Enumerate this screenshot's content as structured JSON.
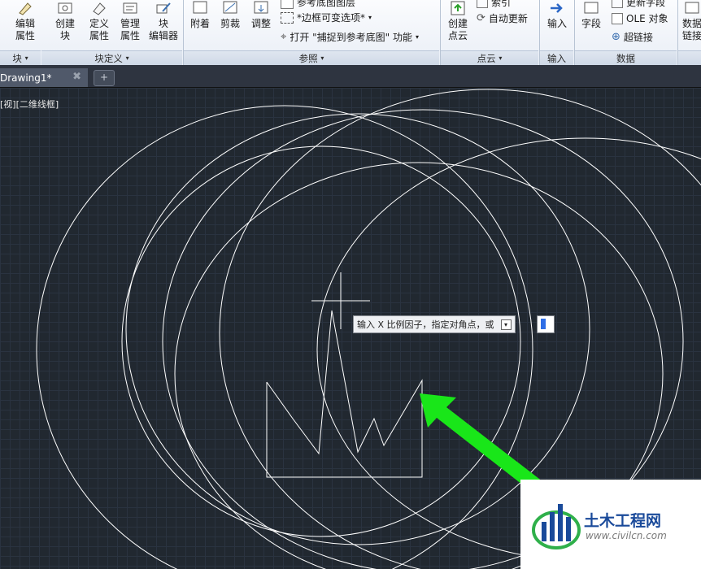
{
  "ribbon": {
    "tools": [
      {
        "id": "edit-attributes",
        "label_top": "编辑",
        "label_bottom": "属性"
      },
      {
        "id": "create-block",
        "label_top": "创建",
        "label_bottom": "块"
      },
      {
        "id": "define-attributes",
        "label_top": "定义",
        "label_bottom": "属性"
      },
      {
        "id": "manage-attributes",
        "label_top": "管理",
        "label_bottom": "属性"
      },
      {
        "id": "block-editor",
        "label_top": "块",
        "label_bottom": "编辑器"
      },
      {
        "id": "attach",
        "label_top": "附着"
      },
      {
        "id": "clip",
        "label_top": "剪裁"
      },
      {
        "id": "adjust",
        "label_top": "调整"
      },
      {
        "id": "create-point-cloud",
        "label_top": "创建",
        "label_bottom": "点云"
      },
      {
        "id": "input",
        "label_top": "输入"
      },
      {
        "id": "field",
        "label_top": "字段"
      },
      {
        "id": "data-link",
        "label_top": "数据",
        "label_bottom": "链接"
      }
    ],
    "small_items": {
      "underlay_layers": "参考底图图层",
      "frame_variable": "*边框可变选项*",
      "open_snap": "打开 \"捕捉到参考底图\" 功能",
      "index": "索引",
      "auto_update": "自动更新",
      "update_fields": "更新字段",
      "ole_object": "OLE 对象",
      "hyperlink": "超链接"
    },
    "panels": {
      "block": "块",
      "block_definition": "块定义",
      "reference": "参照",
      "point_cloud": "点云",
      "import": "输入",
      "data": "数据"
    }
  },
  "tabs": [
    {
      "title": "Drawing1*"
    }
  ],
  "viewport_label": "[视][二维线框]",
  "prompt": {
    "tooltip_text": "输入 X 比例因子，指定对角点，或",
    "input_value": ""
  },
  "watermark": {
    "name": "土木工程网",
    "url": "www.civilcn.com"
  },
  "colors": {
    "arrow": "#19e619",
    "lines": "#ffffff",
    "canvas": "#212830"
  }
}
